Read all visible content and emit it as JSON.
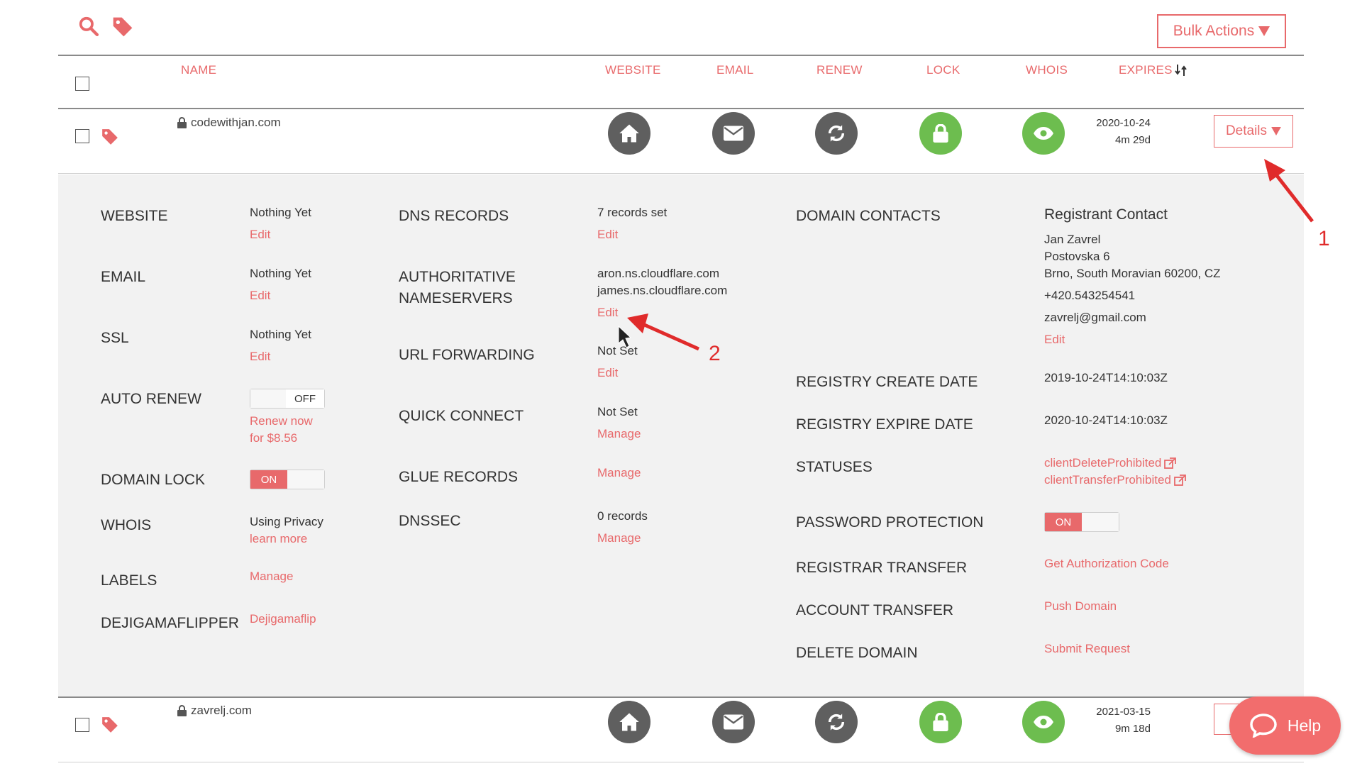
{
  "toolbar": {
    "bulk_actions_label": "Bulk Actions"
  },
  "columns": {
    "name": "NAME",
    "website": "WEBSITE",
    "email": "EMAIL",
    "renew": "RENEW",
    "lock": "LOCK",
    "whois": "WHOIS",
    "expires": "EXPIRES"
  },
  "rows": [
    {
      "domain": "codewithjan.com",
      "expires_date": "2020-10-24",
      "expires_left": "4m 29d",
      "details_label": "Details"
    },
    {
      "domain": "zavrelj.com",
      "expires_date": "2021-03-15",
      "expires_left": "9m 18d"
    }
  ],
  "details": {
    "col1": {
      "website_label": "WEBSITE",
      "website_value": "Nothing Yet",
      "website_action": "Edit",
      "email_label": "EMAIL",
      "email_value": "Nothing Yet",
      "email_action": "Edit",
      "ssl_label": "SSL",
      "ssl_value": "Nothing Yet",
      "ssl_action": "Edit",
      "auto_renew_label": "AUTO RENEW",
      "auto_renew_state": "OFF",
      "renew_now_line1": "Renew now",
      "renew_now_line2": "for $8.56",
      "domain_lock_label": "DOMAIN LOCK",
      "domain_lock_state": "ON",
      "whois_label": "WHOIS",
      "whois_value": "Using Privacy",
      "whois_action": "learn more",
      "labels_label": "LABELS",
      "labels_action": "Manage",
      "dejigama_label": "DEJIGAMAFLIPPER",
      "dejigama_action": "Dejigamaflip"
    },
    "col2": {
      "dns_label": "DNS RECORDS",
      "dns_value": "7 records set",
      "dns_action": "Edit",
      "auth_label_line1": "AUTHORITATIVE",
      "auth_label_line2": "NAMESERVERS",
      "ns1": "aron.ns.cloudflare.com",
      "ns2": "james.ns.cloudflare.com",
      "auth_action": "Edit",
      "url_label": "URL FORWARDING",
      "url_value": "Not Set",
      "url_action": "Edit",
      "quick_label": "QUICK CONNECT",
      "quick_value": "Not Set",
      "quick_action": "Manage",
      "glue_label": "GLUE RECORDS",
      "glue_action": "Manage",
      "dnssec_label": "DNSSEC",
      "dnssec_value": "0 records",
      "dnssec_action": "Manage"
    },
    "col3": {
      "contacts_label": "DOMAIN CONTACTS",
      "registrant_title": "Registrant Contact",
      "registrant_name": "Jan Zavrel",
      "registrant_street": "Postovska 6",
      "registrant_city": "Brno, South Moravian 60200, CZ",
      "registrant_phone": "+420.543254541",
      "registrant_email": "zavrelj@gmail.com",
      "registrant_action": "Edit",
      "create_label": "REGISTRY CREATE DATE",
      "create_value": "2019-10-24T14:10:03Z",
      "expire_label": "REGISTRY EXPIRE DATE",
      "expire_value": "2020-10-24T14:10:03Z",
      "statuses_label": "STATUSES",
      "status1": "clientDeleteProhibited",
      "status2": "clientTransferProhibited",
      "password_label": "PASSWORD PROTECTION",
      "password_state": "ON",
      "registrar_label": "REGISTRAR TRANSFER",
      "registrar_action": "Get Authorization Code",
      "account_label": "ACCOUNT TRANSFER",
      "account_action": "Push Domain",
      "delete_label": "DELETE DOMAIN",
      "delete_action": "Submit Request"
    }
  },
  "annotations": {
    "one": "1",
    "two": "2"
  },
  "help_label": "Help",
  "icons": [
    "search-icon",
    "tag-icon",
    "caret-down-icon",
    "lock-icon",
    "home-icon",
    "envelope-icon",
    "refresh-icon",
    "padlock-icon",
    "eye-icon",
    "external-link-icon",
    "chat-icon",
    "cursor-icon"
  ],
  "colors": {
    "accent": "#e8696b",
    "grey_circle": "#5f5f5f",
    "green_circle": "#6dbd4f",
    "annotation": "#e02b2b",
    "panel_bg": "#f2f2f2"
  }
}
